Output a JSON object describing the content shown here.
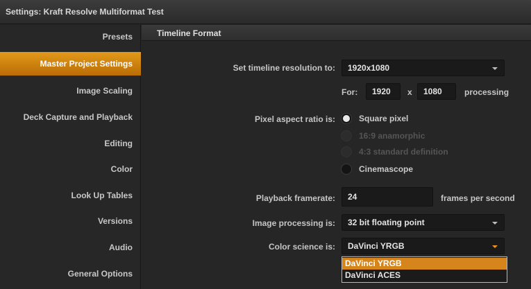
{
  "window": {
    "title": "Settings:  Kraft Resolve Multiformat Test"
  },
  "sidebar": {
    "items": [
      {
        "label": "Presets"
      },
      {
        "label": "Master Project Settings"
      },
      {
        "label": "Image Scaling"
      },
      {
        "label": "Deck Capture and Playback"
      },
      {
        "label": "Editing"
      },
      {
        "label": "Color"
      },
      {
        "label": "Look Up Tables"
      },
      {
        "label": "Versions"
      },
      {
        "label": "Audio"
      },
      {
        "label": "General Options"
      }
    ],
    "active_index": 1,
    "accent_color": "#e29a1a"
  },
  "main": {
    "section_title": "Timeline Format",
    "resolution": {
      "label": "Set timeline resolution to:",
      "value": "1920x1080",
      "for_label": "For:",
      "width": "1920",
      "x_label": "x",
      "height": "1080",
      "suffix": "processing"
    },
    "pixel_aspect": {
      "label": "Pixel aspect ratio is:",
      "options": [
        {
          "label": "Square pixel",
          "state": "checked"
        },
        {
          "label": "16:9 anamorphic",
          "state": "disabled"
        },
        {
          "label": "4:3 standard definition",
          "state": "disabled"
        },
        {
          "label": "Cinemascope",
          "state": "enabled"
        }
      ]
    },
    "framerate": {
      "label": "Playback framerate:",
      "value": "24",
      "unit": "frames per second"
    },
    "processing": {
      "label": "Image processing is:",
      "value": "32 bit floating point"
    },
    "color_science": {
      "label": "Color science is:",
      "value": "DaVinci YRGB",
      "options": [
        "DaVinci YRGB",
        "DaVinci ACES"
      ],
      "highlighted_index": 0
    }
  }
}
